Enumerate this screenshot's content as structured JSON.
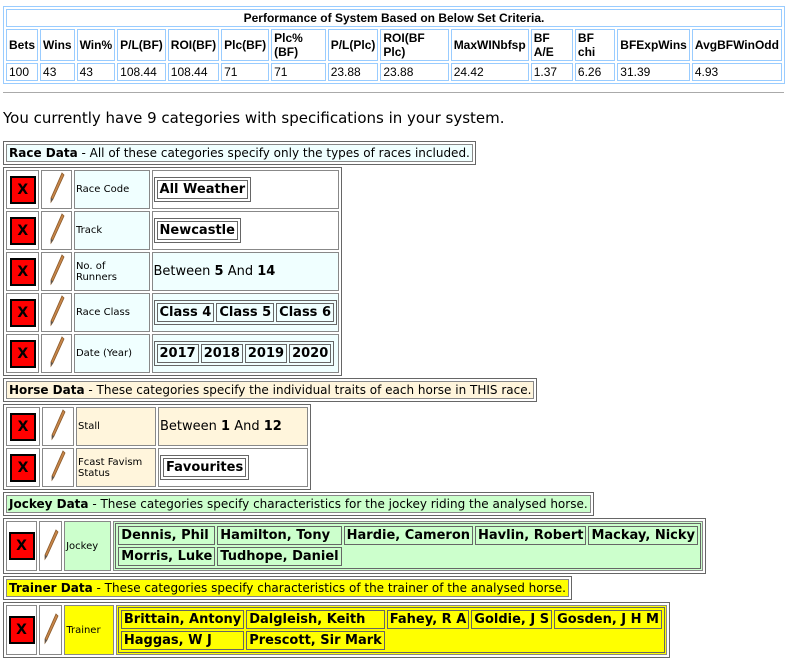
{
  "performance": {
    "title": "Performance of System Based on Below Set Criteria.",
    "headers": [
      "Bets",
      "Wins",
      "Win%",
      "P/L(BF)",
      "ROI(BF)",
      "Plc(BF)",
      "Plc%(BF)",
      "P/L(Plc)",
      "ROI(BF Plc)",
      "MaxWINbfsp",
      "BF A/E",
      "BF chi",
      "BFExpWins",
      "AvgBFWinOdd"
    ],
    "values": [
      "100",
      "43",
      "43",
      "108.44",
      "108.44",
      "71",
      "71",
      "23.88",
      "23.88",
      "24.42",
      "1.37",
      "6.26",
      "31.39",
      "4.93"
    ]
  },
  "intro": "You currently have 9 categories with specifications in your system.",
  "delete_label": "X",
  "colors": {
    "race": "#f0ffff",
    "horse": "#fff5dc",
    "jockey": "#ccffcc",
    "trainer": "#ffff00",
    "delete": "#ff0000"
  },
  "race": {
    "title": "Race Data",
    "desc": " - All of these categories specify only the types of races included.",
    "race_code": {
      "label": "Race Code",
      "values": [
        "All Weather"
      ]
    },
    "track": {
      "label": "Track",
      "values": [
        "Newcastle"
      ]
    },
    "runners": {
      "label": "No. of Runners",
      "between": "Between ",
      "and": " And ",
      "min": "5",
      "max": "14"
    },
    "race_class": {
      "label": "Race Class",
      "values": [
        "Class 4",
        "Class 5",
        "Class 6"
      ]
    },
    "year": {
      "label": "Date (Year)",
      "values": [
        "2017",
        "2018",
        "2019",
        "2020"
      ]
    }
  },
  "horse": {
    "title": "Horse Data",
    "desc": " - These categories specify the individual traits of each horse in THIS race.",
    "stall": {
      "label": "Stall",
      "between": "Between ",
      "and": " And ",
      "min": "1",
      "max": "12"
    },
    "fcast": {
      "label": "Fcast Favism Status",
      "values": [
        "Favourites"
      ]
    }
  },
  "jockey": {
    "title": "Jockey Data",
    "desc": " - These categories specify characteristics for the jockey riding the analysed horse.",
    "label": "Jockey",
    "rows": [
      [
        "Dennis, Phil",
        "Hamilton, Tony",
        "Hardie, Cameron",
        "Havlin, Robert",
        "Mackay, Nicky"
      ],
      [
        "Morris, Luke",
        "Tudhope, Daniel"
      ]
    ]
  },
  "trainer": {
    "title": "Trainer Data",
    "desc": " - These categories specify characteristics of the trainer of the analysed horse.",
    "label": "Trainer",
    "rows": [
      [
        "Brittain, Antony",
        "Dalgleish, Keith",
        "Fahey, R A",
        "Goldie, J S",
        "Gosden, J H M"
      ],
      [
        "Haggas, W J",
        "Prescott, Sir Mark"
      ]
    ]
  }
}
